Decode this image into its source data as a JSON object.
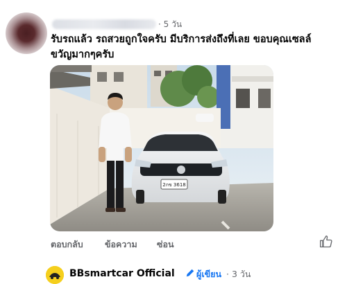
{
  "comment": {
    "time": "· 5 วัน",
    "text": "รับรถแล้ว รถสวยถูกใจครับ มีบริการส่งถึงที่เลย ขอบคุณเซลล์ขวัญมากๆครับ",
    "plate_text": "2กข 3618",
    "actions": {
      "reply": "ตอบกลับ",
      "message": "ข้อความ",
      "hide": "ซ่อน"
    }
  },
  "reply": {
    "name": "BBsmartcar Official",
    "author_badge": "ผู้เขียน",
    "time": "· 3 วัน"
  },
  "colors": {
    "meta_gray": "#65676b",
    "link_blue": "#1877f2",
    "logo_yellow": "#f5cf1d"
  }
}
